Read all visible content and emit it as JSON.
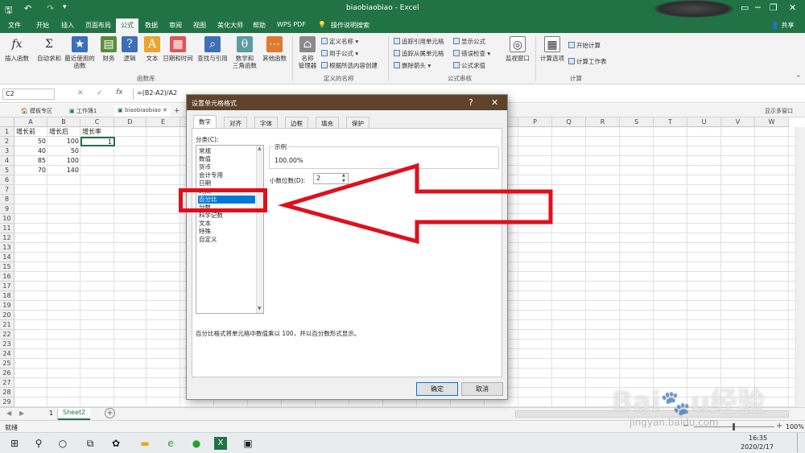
{
  "titlebar": {
    "title": "biaobiaobiao  -  Excel",
    "share": "共享"
  },
  "tabs": [
    "文件",
    "开始",
    "插入",
    "页面布局",
    "公式",
    "数据",
    "审阅",
    "视图",
    "美化大师",
    "帮助",
    "WPS PDF",
    "操作说明搜索"
  ],
  "ribbon": {
    "insert_fn": "插入函数",
    "autosum": "自动求和",
    "recent": "最近使用的\n函数",
    "finance": "财务",
    "logic": "逻辑",
    "text": "文本",
    "datetime": "日期和时间",
    "lookup": "查找与引用",
    "math": "数学和\n三角函数",
    "more": "其他函数",
    "group_lib": "函数库",
    "name_mgr": "名称\n管理器",
    "define_name": "定义名称",
    "use_in_formula": "用于公式",
    "create_from_sel": "根据所选内容创建",
    "group_names": "定义的名称",
    "trace_prec": "追踪引用单元格",
    "trace_dep": "追踪从属单元格",
    "remove_arrows": "删除箭头",
    "show_formulas": "显示公式",
    "error_check": "错误检查",
    "eval_formula": "公式求值",
    "group_audit": "公式审核",
    "watch": "监视窗口",
    "calc_options": "计算选项",
    "calc_now": "开始计算",
    "calc_sheet": "计算工作表",
    "group_calc": "计算"
  },
  "formulabar": {
    "namebox": "C2",
    "formula": "=(B2-A2)/A2",
    "fx": "fx"
  },
  "wbtabs": {
    "t1": "模板专区",
    "t2": "工作簿1",
    "t3": "biaobiaobiao",
    "show_multi": "显示多窗口"
  },
  "grid": {
    "columns": [
      "A",
      "B",
      "C",
      "D",
      "E",
      "F",
      "G",
      "H",
      "I",
      "J",
      "K",
      "L",
      "M",
      "N",
      "O",
      "P",
      "Q",
      "R",
      "S",
      "T",
      "U",
      "V",
      "W"
    ],
    "rows": [
      "1",
      "2",
      "3",
      "4",
      "5",
      "6",
      "7",
      "8",
      "9",
      "10",
      "11",
      "12",
      "13",
      "14",
      "15",
      "16",
      "17",
      "18",
      "19",
      "20",
      "21",
      "22",
      "23",
      "24",
      "25",
      "26",
      "27",
      "28",
      "29"
    ],
    "a1": "增长前",
    "b1": "增长后",
    "c1": "增长率",
    "a2": "50",
    "b2": "100",
    "c2": "1",
    "a3": "40",
    "b3": "50",
    "a4": "85",
    "b4": "100",
    "a5": "70",
    "b5": "140"
  },
  "sheet": {
    "tab1": "1",
    "tab2": "Sheet2",
    "add": "+"
  },
  "status": {
    "ready": "就绪",
    "zoom": "100%"
  },
  "taskbar": {
    "time": "16:35",
    "date": "2020/2/17"
  },
  "dialog": {
    "title": "设置单元格格式",
    "help": "?",
    "close": "✕",
    "tabs": [
      "数字",
      "对齐",
      "字体",
      "边框",
      "填充",
      "保护"
    ],
    "category_label": "分类(C):",
    "categories": [
      "常规",
      "数值",
      "货币",
      "会计专用",
      "日期",
      "时间",
      "百分比",
      "分数",
      "科学记数",
      "文本",
      "特殊",
      "自定义"
    ],
    "sample_label": "示例",
    "sample_value": "100.00%",
    "decimals_label": "小数位数(D):",
    "decimals_value": "2",
    "description": "百分比格式将单元格中数值乘以 100，并以百分数形式显示。",
    "ok": "确定",
    "cancel": "取消"
  },
  "colors": {
    "excel_green": "#217346",
    "dialog_title": "#5e4229",
    "highlight_red": "#e00f1d",
    "selection_blue": "#0078d7"
  }
}
